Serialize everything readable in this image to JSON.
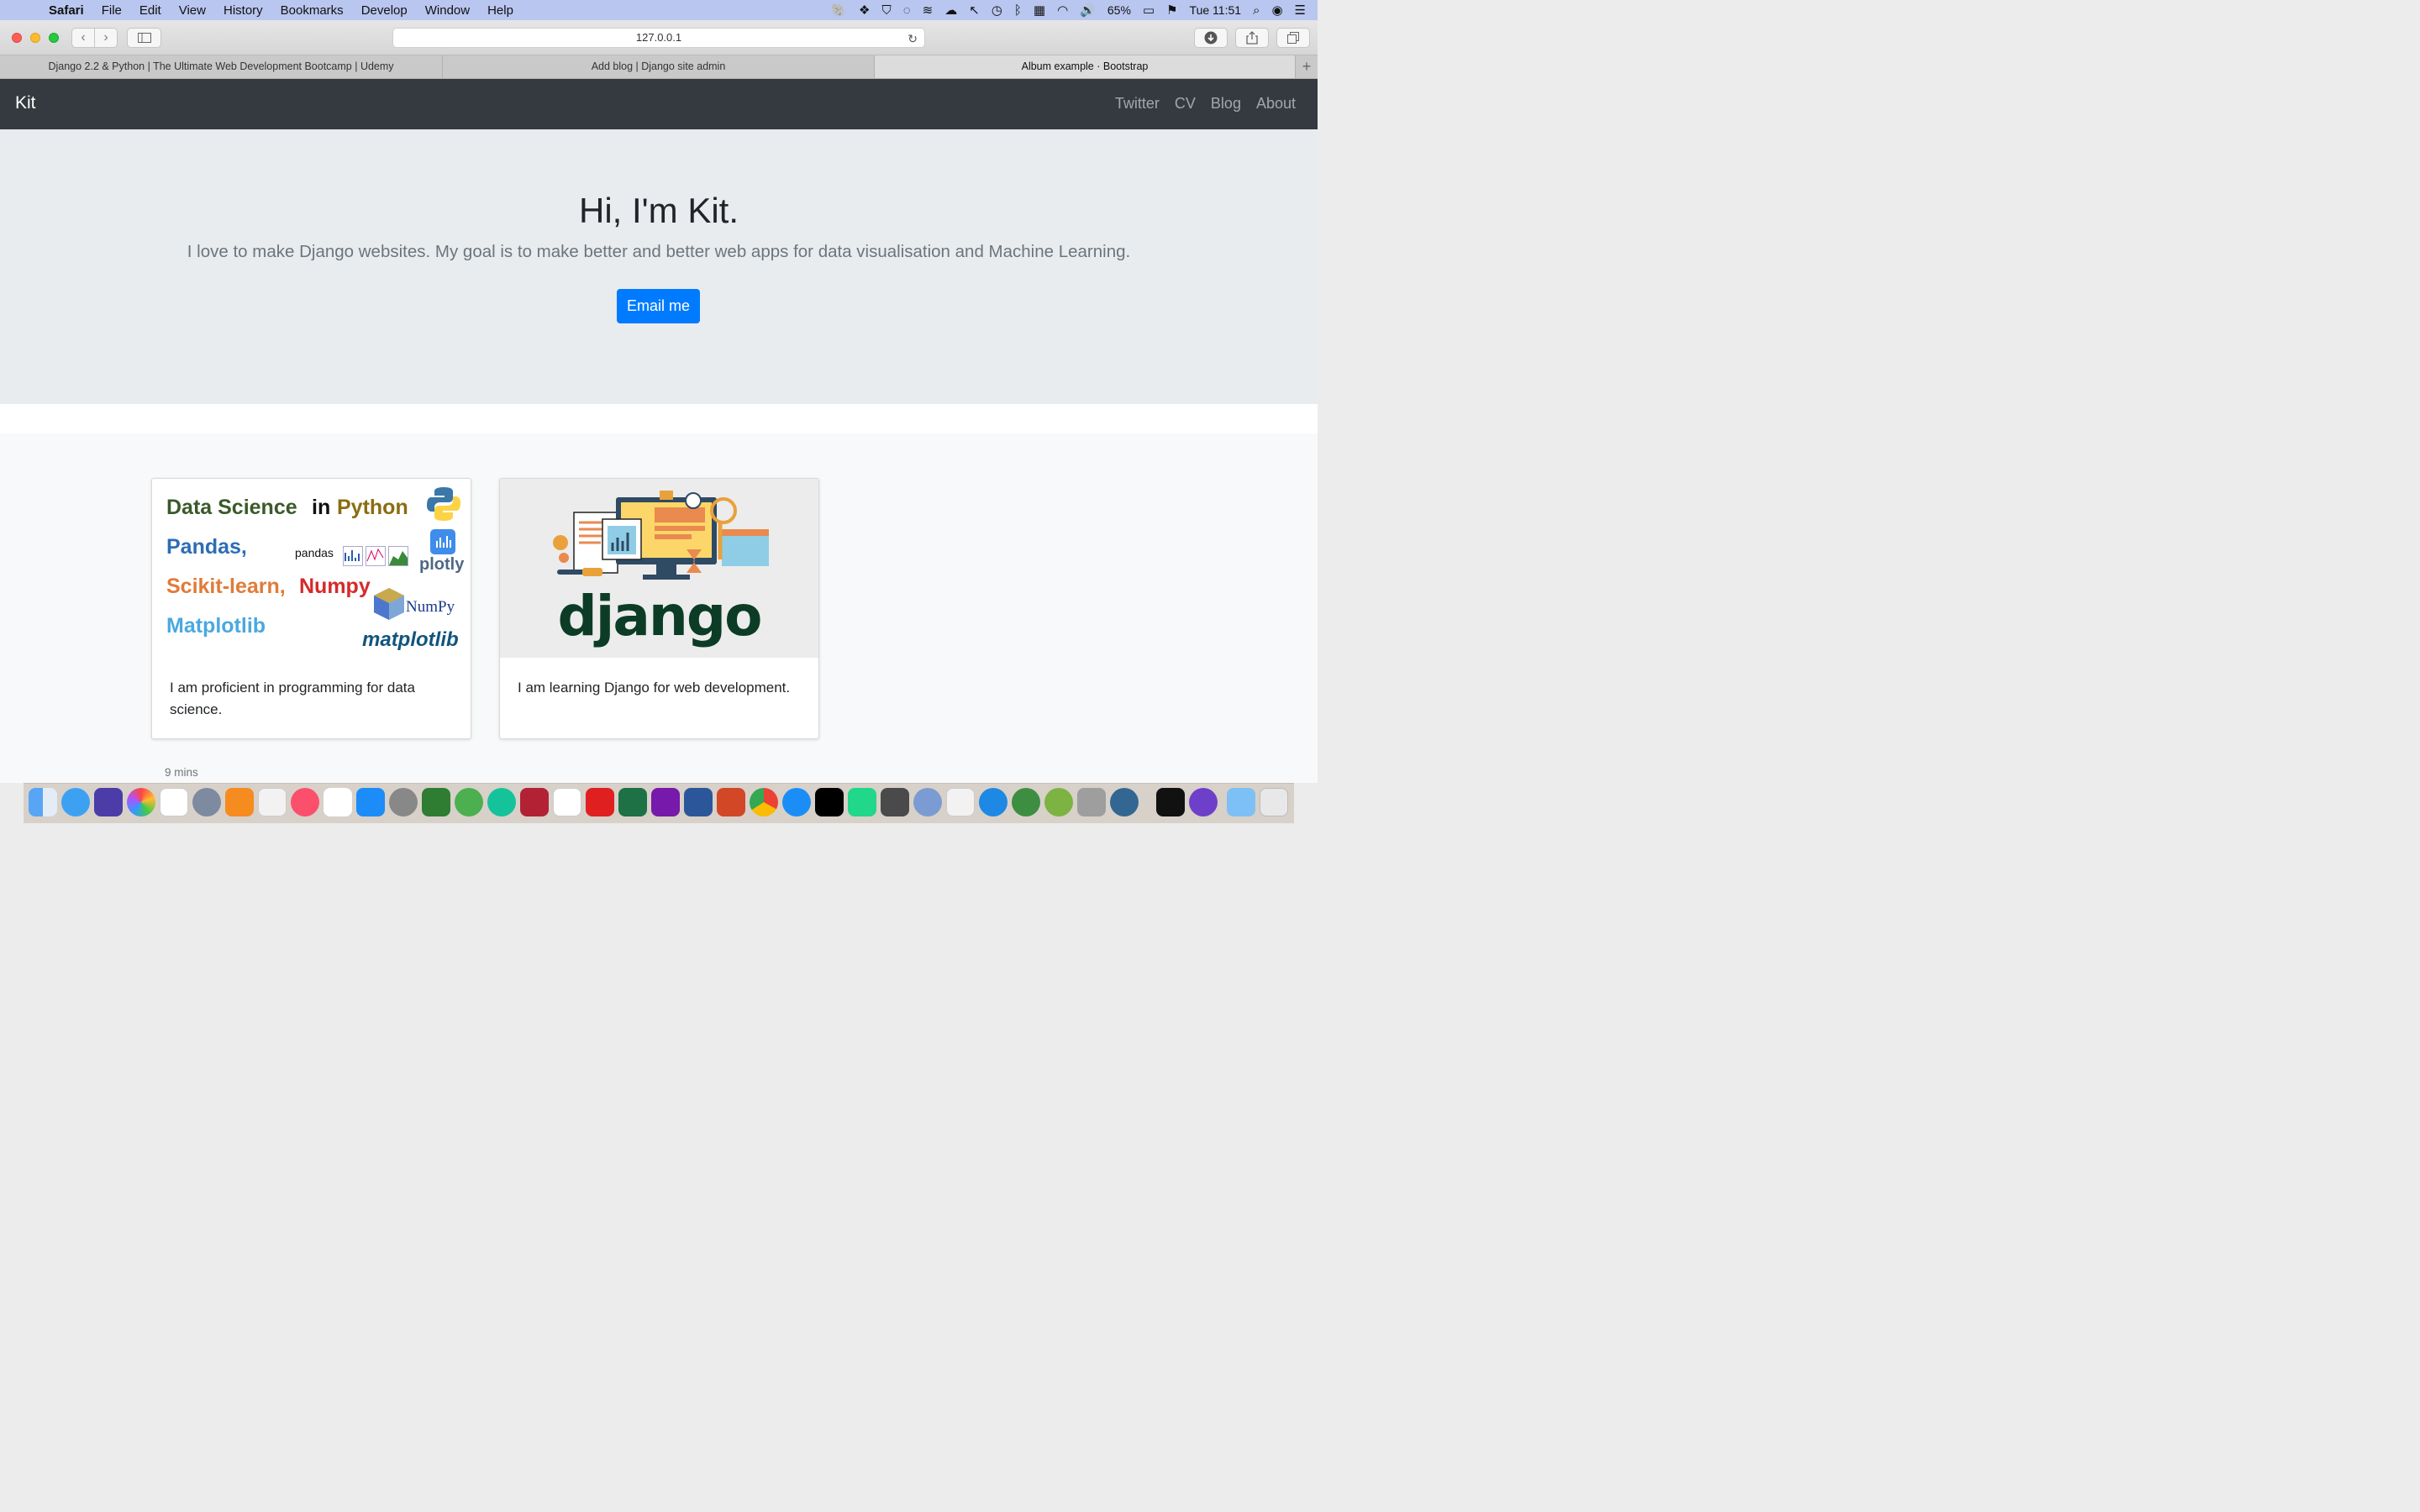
{
  "menubar": {
    "app_name": "Safari",
    "items": [
      "File",
      "Edit",
      "View",
      "History",
      "Bookmarks",
      "Develop",
      "Window",
      "Help"
    ],
    "battery": "65%",
    "clock": "Tue 11:51"
  },
  "browser": {
    "url": "127.0.0.1",
    "tabs": [
      "Django 2.2 & Python | The Ultimate Web Development Bootcamp | Udemy",
      "Add blog | Django site admin",
      "Album example · Bootstrap"
    ],
    "new_tab": "+"
  },
  "site": {
    "brand": "Kit",
    "nav": [
      "Twitter",
      "CV",
      "Blog",
      "About"
    ],
    "hero_title": "Hi, I'm Kit.",
    "hero_lead": "I love to make Django websites. My goal is to make better and better web apps for data visualisation and Machine Learning.",
    "cta": "Email me",
    "cards": [
      {
        "text": "I am proficient in programming for data science.",
        "image_words": {
          "line1a": "Data Science",
          "line1b": "in",
          "line1c": "Python",
          "pandas": "Pandas,",
          "pandas_logo": "pandas",
          "plotly": "plotly",
          "sklearn": "Scikit-learn,",
          "numpy": "Numpy",
          "numpy_logo": "NumPy",
          "matplotlib": "Matplotlib",
          "matplotlib_logo": "matplotlib"
        }
      },
      {
        "text": "I am learning Django for web development.",
        "image_word": "django"
      }
    ],
    "footer_note": "9 mins"
  },
  "colors": {
    "navbar": "#343a40",
    "jumbotron": "#e9ecef",
    "primary": "#007bff",
    "django_green": "#0c3c26"
  }
}
